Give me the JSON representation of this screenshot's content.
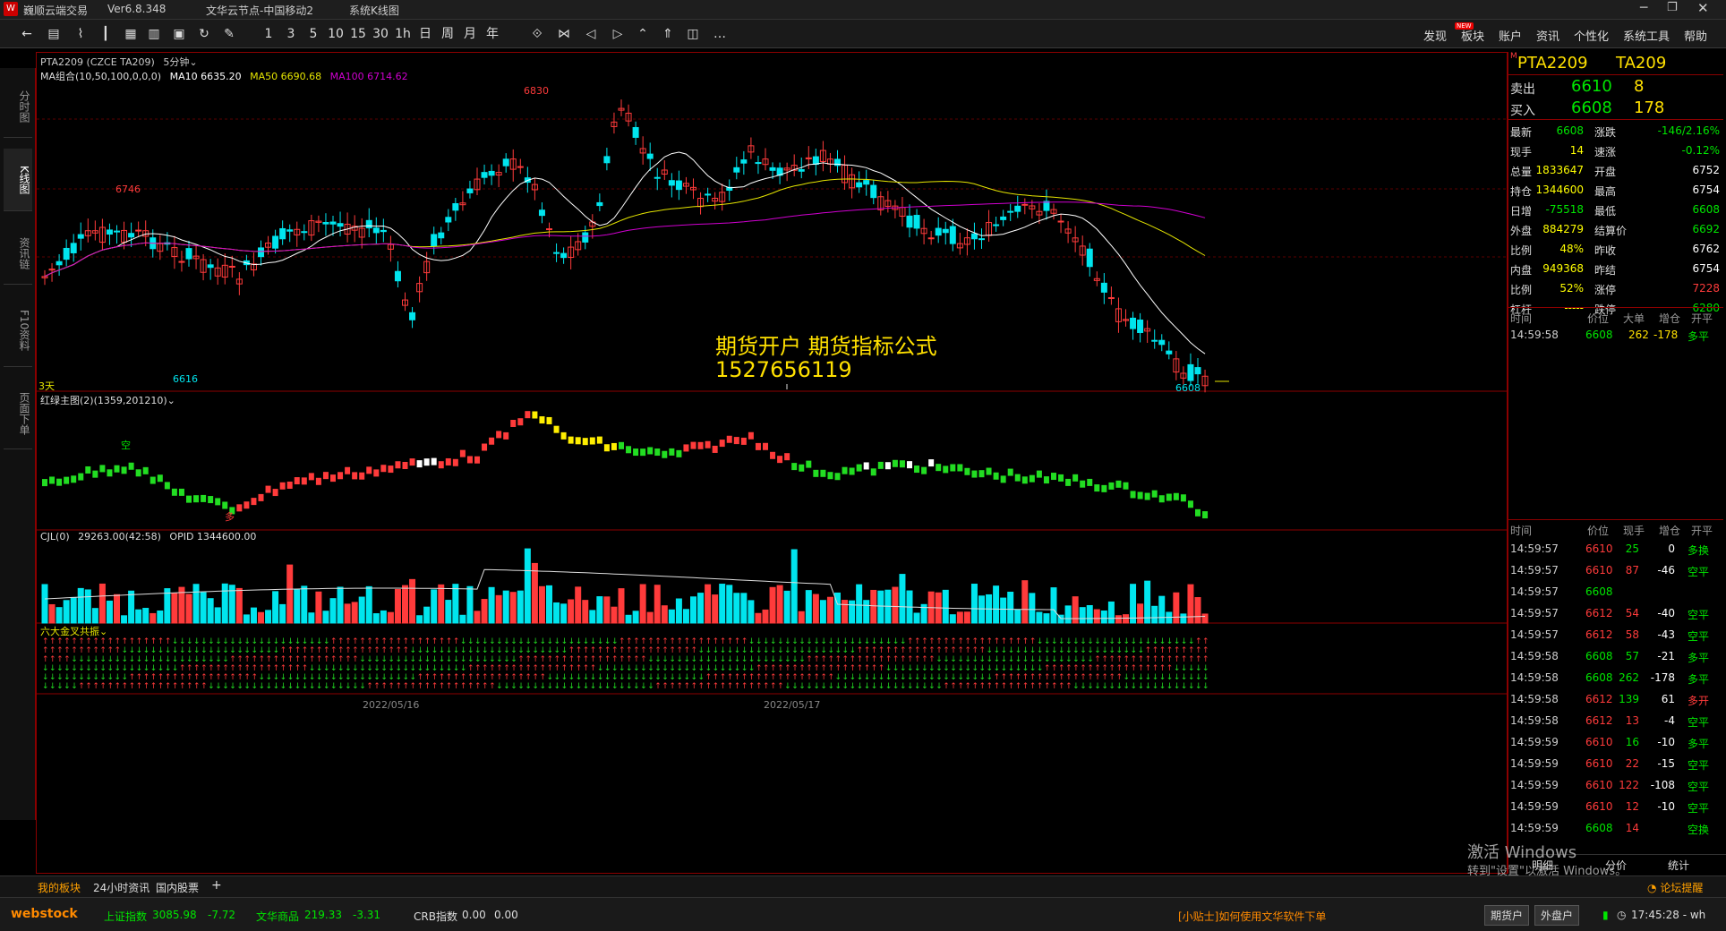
{
  "app": {
    "title": "巍顺云端交易",
    "version": "Ver6.8.348",
    "server": "文华云节点-中国移动2",
    "kline_menu": "系统K线图"
  },
  "toolbar": {
    "periods": [
      "1",
      "3",
      "5",
      "10",
      "15",
      "30",
      "1h",
      "日",
      "周",
      "月",
      "年"
    ],
    "right_menu": [
      "发现",
      "板块",
      "账户",
      "资讯",
      "个性化",
      "系统工具",
      "帮助"
    ],
    "new_badge": "NEW"
  },
  "left_tabs": [
    "分时图",
    "K线图",
    "资讯链",
    "F10资料",
    "页面下单"
  ],
  "chart": {
    "contract_tag": "PTA2209",
    "contract_code": "(CZCE TA209)",
    "interval": "5分钟",
    "ma_label": "MA组合(10,50,100,0,0,0)",
    "ma10": "MA10 6635.20",
    "ma50": "MA50 6690.68",
    "ma100": "MA100 6714.62",
    "high_labels": [
      "6830",
      "6746"
    ],
    "low_labels": [
      "6616",
      "6608"
    ],
    "days_label": "3天",
    "watermark_1": "期货开户 期货指标公式",
    "watermark_2": "1527656119",
    "ind1_label": "红绿主图(2)(1359,201210)",
    "ind_marks": {
      "kong": "空",
      "duo": "多"
    },
    "vol_label": "CJL(0)",
    "vol_value": "29263.00(42:58)",
    "opid": "OPID 1344600.00",
    "six_label": "六大金叉共振",
    "dates": [
      "2022/05/16",
      "2022/05/17"
    ],
    "colors": {
      "up": "#ff3b3b",
      "down": "#00e5ee",
      "ma10": "#ffffff",
      "ma50": "#e5e500",
      "ma100": "#d000d0"
    }
  },
  "quote": {
    "title_name": "PTA2209",
    "title_code": "TA209",
    "sell_label": "卖出",
    "sell_price": "6610",
    "sell_vol": "8",
    "buy_label": "买入",
    "buy_price": "6608",
    "buy_vol": "178",
    "fields": [
      {
        "l1": "最新",
        "v1": "6608",
        "l2": "涨跌",
        "v2": "-146/2.16%"
      },
      {
        "l1": "现手",
        "v1": "14",
        "l2": "速涨",
        "v2": "-0.12%"
      },
      {
        "l1": "总量",
        "v1": "1833647",
        "l2": "开盘",
        "v2": "6752"
      },
      {
        "l1": "持仓",
        "v1": "1344600",
        "l2": "最高",
        "v2": "6754"
      },
      {
        "l1": "日增",
        "v1": "-75518",
        "l2": "最低",
        "v2": "6608"
      },
      {
        "l1": "外盘",
        "v1": "884279",
        "l2": "结算价",
        "v2": "6692"
      },
      {
        "l1": "比例",
        "v1": "48%",
        "l2": "昨收",
        "v2": "6762"
      },
      {
        "l1": "内盘",
        "v1": "949368",
        "l2": "昨结",
        "v2": "6754"
      },
      {
        "l1": "比例",
        "v1": "52%",
        "l2": "涨停",
        "v2": "7228"
      },
      {
        "l1": "杠杆",
        "v1": "-----",
        "l2": "跌停",
        "v2": "6280"
      }
    ],
    "trade_headers": [
      "时间",
      "价位",
      "大单",
      "增仓",
      "开平"
    ],
    "big_trade": {
      "t": "14:59:58",
      "p": "6608",
      "v": "262",
      "d": "-178",
      "k": "多平"
    },
    "tick_headers": [
      "时间",
      "价位",
      "现手",
      "增仓",
      "开平"
    ],
    "ticks": [
      {
        "t": "14:59:57",
        "p": "6610",
        "v": "25",
        "d": "0",
        "k": "多换"
      },
      {
        "t": "14:59:57",
        "p": "6610",
        "v": "87",
        "d": "-46",
        "k": "空平"
      },
      {
        "t": "14:59:57",
        "p": "6608",
        "v": "",
        "d": "",
        "k": ""
      },
      {
        "t": "14:59:57",
        "p": "6612",
        "v": "54",
        "d": "-40",
        "k": "空平"
      },
      {
        "t": "14:59:57",
        "p": "6612",
        "v": "58",
        "d": "-43",
        "k": "空平"
      },
      {
        "t": "14:59:58",
        "p": "6608",
        "v": "57",
        "d": "-21",
        "k": "多平"
      },
      {
        "t": "14:59:58",
        "p": "6608",
        "v": "262",
        "d": "-178",
        "k": "多平"
      },
      {
        "t": "14:59:58",
        "p": "6612",
        "v": "139",
        "d": "61",
        "k": "多开"
      },
      {
        "t": "14:59:58",
        "p": "6612",
        "v": "13",
        "d": "-4",
        "k": "空平"
      },
      {
        "t": "14:59:59",
        "p": "6610",
        "v": "16",
        "d": "-10",
        "k": "多平"
      },
      {
        "t": "14:59:59",
        "p": "6610",
        "v": "22",
        "d": "-15",
        "k": "空平"
      },
      {
        "t": "14:59:59",
        "p": "6610",
        "v": "122",
        "d": "-108",
        "k": "空平"
      },
      {
        "t": "14:59:59",
        "p": "6610",
        "v": "12",
        "d": "-10",
        "k": "空平"
      },
      {
        "t": "14:59:59",
        "p": "6608",
        "v": "14",
        "d": "",
        "k": "空换"
      }
    ],
    "bottom_tabs": [
      "明细",
      "分价",
      "统计"
    ]
  },
  "win_activate": {
    "line1": "激活 Windows",
    "line2": "转到\"设置\"以激活 Windows。"
  },
  "bottom_tabs": [
    "我的板块",
    "24小时资讯",
    "国内股票",
    "+"
  ],
  "status": {
    "brand": "webstock",
    "idx1_name": "上证指数",
    "idx1_val": "3085.98",
    "idx1_chg": "-7.72",
    "idx2_name": "文华商品",
    "idx2_val": "219.33",
    "idx2_chg": "-3.31",
    "idx3_name": "CRB指数",
    "idx3_val": "0.00",
    "idx3_chg": "0.00",
    "tip": "[小贴士]如何使用文华软件下单",
    "btn1": "期货户",
    "btn2": "外盘户",
    "clock": "17:45:28 - wh",
    "forum": "论坛提醒"
  }
}
